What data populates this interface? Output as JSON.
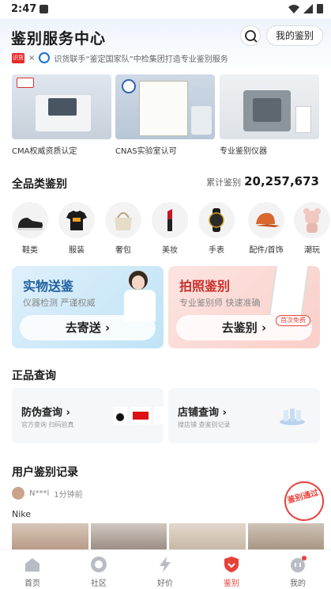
{
  "status": {
    "time": "2:47"
  },
  "header": {
    "title": "鉴别服务中心",
    "my_auth": "我的鉴别",
    "banner_logo": "识货",
    "banner_x": "×",
    "banner_text": "识货联手“鉴定国家队”中检集团打造专业鉴别服务"
  },
  "certs": [
    {
      "label": "CMA权威资质认定"
    },
    {
      "label": "CNAS实验室认可"
    },
    {
      "label": "专业鉴别仪器"
    }
  ],
  "categories": {
    "title": "全品类鉴别",
    "count_label": "累计鉴别",
    "count": "20,257,673",
    "items": [
      {
        "label": "鞋类",
        "icon": "sneaker-icon"
      },
      {
        "label": "服装",
        "icon": "tshirt-icon"
      },
      {
        "label": "奢包",
        "icon": "bag-icon"
      },
      {
        "label": "美妆",
        "icon": "lipstick-icon"
      },
      {
        "label": "手表",
        "icon": "watch-icon"
      },
      {
        "label": "配件/首饰",
        "icon": "cap-icon"
      },
      {
        "label": "潮玩",
        "icon": "toy-icon"
      }
    ]
  },
  "cards": {
    "physical": {
      "title": "实物送鉴",
      "sub": "仪器检测 严谨权威",
      "button": "去寄送"
    },
    "photo": {
      "title": "拍照鉴别",
      "sub": "专业鉴别师 快速准确",
      "button": "去鉴别",
      "badge": "首次免费"
    }
  },
  "query": {
    "title": "正品查询",
    "anti": {
      "title": "防伪查询",
      "sub": "官方查询 扫码验真"
    },
    "store": {
      "title": "店铺查询",
      "sub": "搜店铺 查鉴别记录"
    }
  },
  "records": {
    "title": "用户鉴别记录",
    "user": "N***l",
    "time": "1分钟前",
    "brand": "Nike",
    "stamp": "鉴别通过"
  },
  "nav": [
    {
      "label": "首页",
      "icon": "home-icon"
    },
    {
      "label": "社区",
      "icon": "community-icon"
    },
    {
      "label": "好价",
      "icon": "deal-icon"
    },
    {
      "label": "鉴别",
      "icon": "shield-icon"
    },
    {
      "label": "我的",
      "icon": "profile-icon"
    }
  ],
  "colors": {
    "accent": "#e8403a",
    "blue": "#1c6fd1"
  }
}
